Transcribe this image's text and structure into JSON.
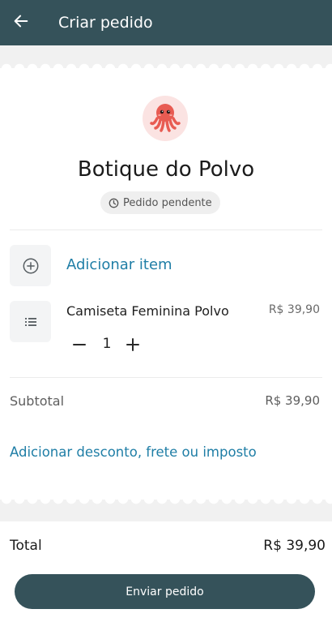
{
  "header": {
    "title": "Criar pedido",
    "back_icon": "arrow-left-icon"
  },
  "store": {
    "name": "Botique do Polvo",
    "avatar_icon": "octopus-icon",
    "status_icon": "clock-icon",
    "status": "Pedido pendente"
  },
  "actions": {
    "add_item_icon": "plus-circle-icon",
    "add_item": "Adicionar item",
    "discount_link": "Adicionar desconto, frete ou imposto"
  },
  "items": [
    {
      "icon": "list-icon",
      "name": "Camiseta Feminina Polvo",
      "price": "R$ 39,90",
      "quantity": "1",
      "decrement_icon": "minus-icon",
      "increment_icon": "plus-icon"
    }
  ],
  "summary": {
    "subtotal_label": "Subtotal",
    "subtotal_value": "R$ 39,90",
    "total_label": "Total",
    "total_value": "R$ 39,90"
  },
  "footer": {
    "submit_label": "Enviar pedido"
  },
  "colors": {
    "primary": "#35525a",
    "link": "#1f7ea6",
    "avatar_bg": "#fbe3e2",
    "octopus": "#e85b52"
  }
}
